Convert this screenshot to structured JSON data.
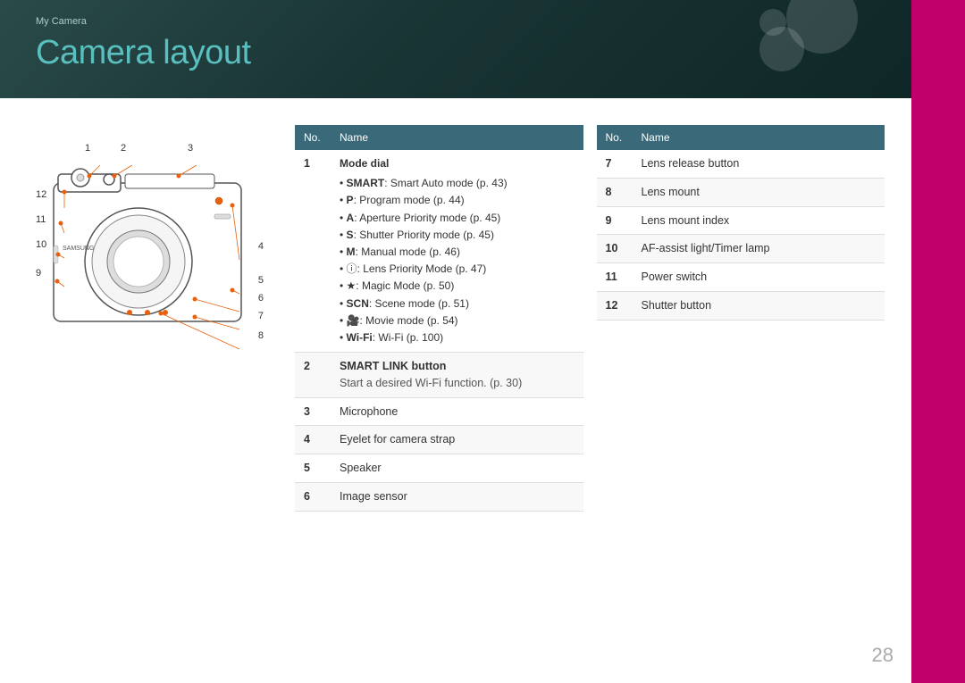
{
  "breadcrumb": "My Camera",
  "title": "Camera layout",
  "page_number": "28",
  "left_table": {
    "header_no": "No.",
    "header_name": "Name",
    "rows": [
      {
        "no": "1",
        "name": "Mode dial",
        "details": [
          {
            "prefix": "SMART",
            "bold": true,
            "text": ": Smart Auto mode (p. 43)"
          },
          {
            "prefix": "P",
            "bold": true,
            "text": ": Program mode (p. 44)"
          },
          {
            "prefix": "A",
            "bold": true,
            "text": ": Aperture Priority mode (p. 45)"
          },
          {
            "prefix": "S",
            "bold": true,
            "text": ": Shutter Priority mode (p. 45)"
          },
          {
            "prefix": "M",
            "bold": true,
            "text": ": Manual mode (p. 46)"
          },
          {
            "prefix": "i",
            "bold": false,
            "icon": true,
            "text": ": Lens Priority Mode (p. 47)"
          },
          {
            "prefix": "★",
            "bold": false,
            "icon": true,
            "text": ": Magic Mode (p. 50)"
          },
          {
            "prefix": "SCN",
            "bold": true,
            "text": ": Scene mode (p. 51)"
          },
          {
            "prefix": "movie",
            "icon": true,
            "text": ": Movie mode (p. 54)"
          },
          {
            "prefix": "Wi-Fi",
            "bold": true,
            "text": ": Wi-Fi (p. 100)"
          }
        ]
      },
      {
        "no": "2",
        "name": "SMART LINK button",
        "sub": "Start a desired Wi-Fi function. (p. 30)"
      },
      {
        "no": "3",
        "name": "Microphone"
      },
      {
        "no": "4",
        "name": "Eyelet for camera strap"
      },
      {
        "no": "5",
        "name": "Speaker"
      },
      {
        "no": "6",
        "name": "Image sensor"
      }
    ]
  },
  "right_table": {
    "header_no": "No.",
    "header_name": "Name",
    "rows": [
      {
        "no": "7",
        "name": "Lens release button"
      },
      {
        "no": "8",
        "name": "Lens mount"
      },
      {
        "no": "9",
        "name": "Lens mount index"
      },
      {
        "no": "10",
        "name": "AF-assist light/Timer lamp"
      },
      {
        "no": "11",
        "name": "Power switch"
      },
      {
        "no": "12",
        "name": "Shutter button"
      }
    ]
  },
  "camera_numbers": [
    "1",
    "2",
    "3",
    "4",
    "5",
    "6",
    "7",
    "8",
    "9",
    "10",
    "11",
    "12"
  ]
}
